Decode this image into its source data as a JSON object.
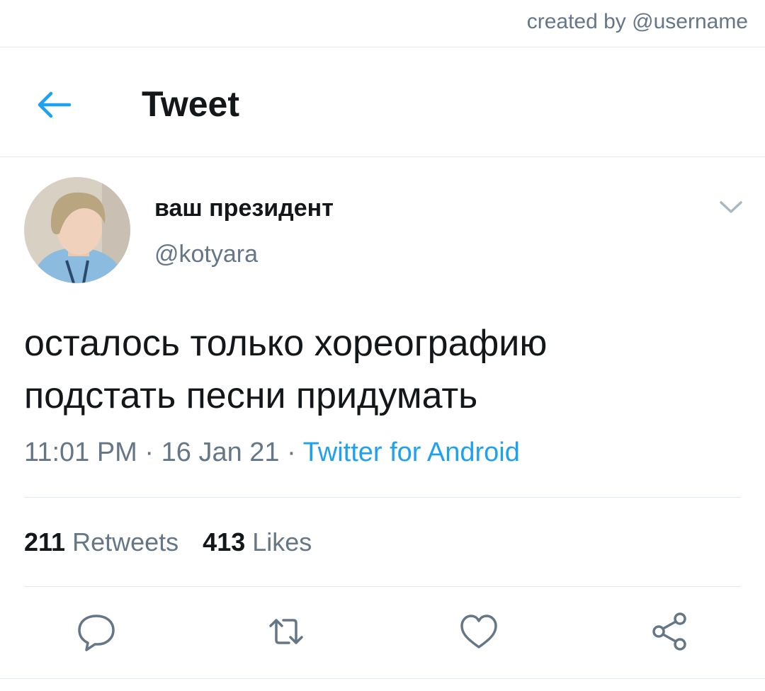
{
  "credit": "created by @username",
  "header": {
    "title": "Tweet"
  },
  "tweet": {
    "display_name": "ваш президент",
    "handle": "@kotyara",
    "text_line1": "осталось только хореографию",
    "text_line2": "подстать песни придумать",
    "time": "11:01 PM",
    "sep1": " · ",
    "date": "16 Jan 21",
    "sep2": " · ",
    "source": "Twitter for Android"
  },
  "stats": {
    "retweets_count": "211",
    "retweets_label": "Retweets",
    "likes_count": "413",
    "likes_label": "Likes"
  },
  "actions": [
    {
      "icon": "reply-icon"
    },
    {
      "icon": "retweet-icon"
    },
    {
      "icon": "like-icon"
    },
    {
      "icon": "share-icon"
    }
  ],
  "colors": {
    "accent": "#1da1f2",
    "text": "#14171a",
    "secondary": "#657786",
    "divider": "#e1e8ed"
  }
}
